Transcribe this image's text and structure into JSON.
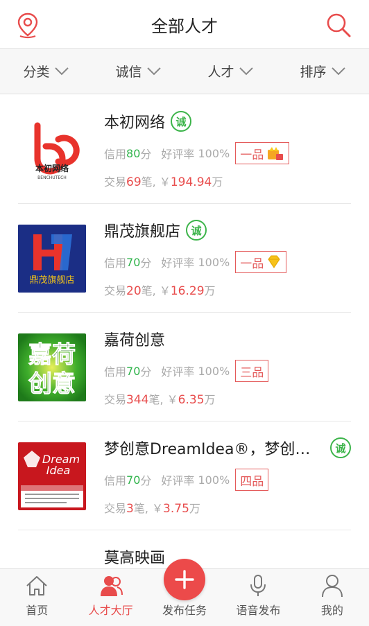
{
  "header": {
    "title": "全部人才",
    "left_icon": "location-pin-icon",
    "right_icon": "search-icon"
  },
  "filters": [
    {
      "label": "分类"
    },
    {
      "label": "诚信"
    },
    {
      "label": "人才"
    },
    {
      "label": "排序"
    }
  ],
  "labels": {
    "credit": "信用",
    "points_unit": "分",
    "rating": "好评率",
    "trade": "交易",
    "deal_unit": "笔, ￥",
    "wan": "万",
    "cheng_badge": "诚"
  },
  "items": [
    {
      "name": "本初网络",
      "verified": true,
      "credit": "80",
      "rating": "100%",
      "grade": "一品",
      "grade_icon": "crown-medal-icon",
      "deals": "69",
      "amount": "194.94",
      "logo_text": "本初网络",
      "logo_subtext": "BENCHUTECH"
    },
    {
      "name": "鼎茂旗舰店",
      "verified": true,
      "credit": "70",
      "rating": "100%",
      "grade": "一品",
      "grade_icon": "diamond-icon",
      "deals": "20",
      "amount": "16.29",
      "logo_text": "鼎茂旗舰店"
    },
    {
      "name": "嘉荷创意",
      "verified": false,
      "credit": "70",
      "rating": "100%",
      "grade": "三品",
      "deals": "344",
      "amount": "6.35",
      "logo_text_1": "嘉荷",
      "logo_text_2": "创意"
    },
    {
      "name": "梦创意DreamIdea®，梦创意...",
      "verified": true,
      "credit": "70",
      "rating": "100%",
      "grade": "四品",
      "deals": "3",
      "amount": "3.75",
      "logo_text_1": "Dream",
      "logo_text_2": "Idea"
    }
  ],
  "partial_item": {
    "name": "莫高映画"
  },
  "tabbar": [
    {
      "label": "首页",
      "icon": "home-icon"
    },
    {
      "label": "人才大厅",
      "icon": "talent-hall-icon",
      "active": true
    },
    {
      "label": "发布任务",
      "icon": "plus-icon"
    },
    {
      "label": "语音发布",
      "icon": "microphone-icon"
    },
    {
      "label": "我的",
      "icon": "user-icon"
    }
  ],
  "colors": {
    "accent_red": "#e84c4c",
    "verified_green": "#3cb44a",
    "muted_text": "#aaaaaa"
  }
}
